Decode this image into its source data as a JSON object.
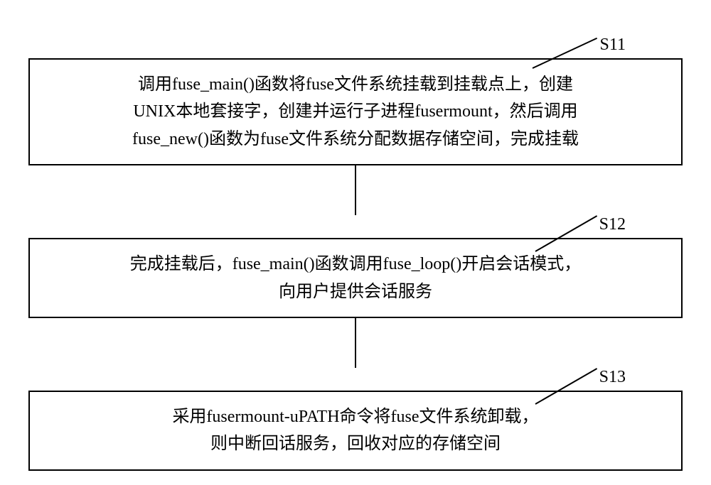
{
  "steps": [
    {
      "label": "S11",
      "text": "调用fuse_main()函数将fuse文件系统挂载到挂载点上，创建\nUNIX本地套接字，创建并运行子进程fusermount，然后调用\nfuse_new()函数为fuse文件系统分配数据存储空间，完成挂载"
    },
    {
      "label": "S12",
      "text": "完成挂载后，fuse_main()函数调用fuse_loop()开启会话模式，\n向用户提供会话服务"
    },
    {
      "label": "S13",
      "text": "采用fusermount-uPATH命令将fuse文件系统卸载，\n则中断回话服务，回收对应的存储空间"
    }
  ]
}
